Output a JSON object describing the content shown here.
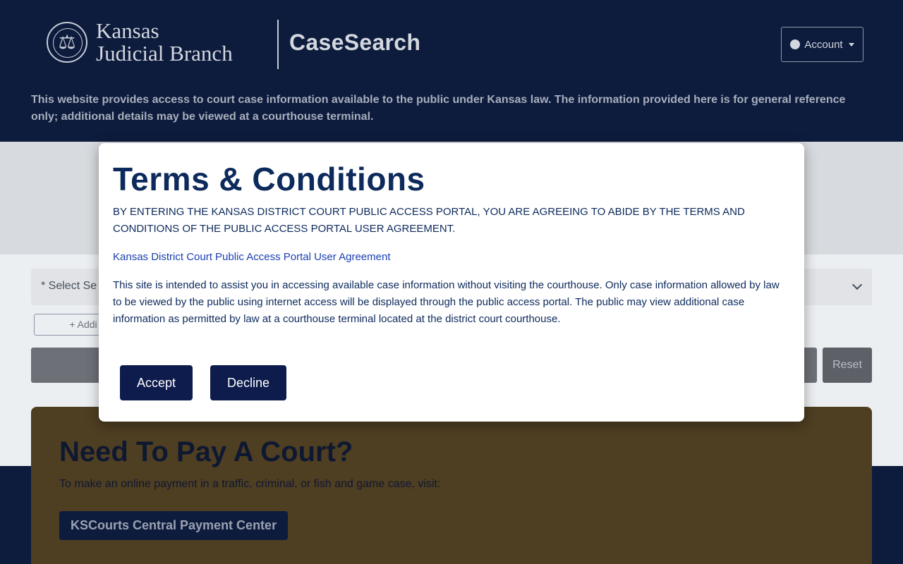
{
  "header": {
    "logo_line1": "Kansas",
    "logo_line2": "Judicial Branch",
    "app_name": "CaseSearch",
    "account_label": "Account",
    "description": "This website provides access to court case information available to the public under Kansas law. The information provided here is for general reference only; additional details may be viewed at a courthouse terminal."
  },
  "search": {
    "select_placeholder": "* Select Se",
    "add_label": "+ Addi",
    "reset_label": "Reset"
  },
  "payment": {
    "title": "Need To Pay A Court?",
    "text": "To make an online payment in a traffic, criminal, or fish and game case, visit:",
    "button_label": "KSCourts Central Payment Center"
  },
  "modal": {
    "title": "Terms & Conditions",
    "upper_text": "BY ENTERING THE KANSAS DISTRICT COURT PUBLIC ACCESS PORTAL, YOU ARE AGREEING TO ABIDE BY THE TERMS AND CONDITIONS OF THE PUBLIC ACCESS PORTAL USER AGREEMENT.",
    "link_text": "Kansas District Court Public Access Portal User Agreement",
    "body_text": "This site is intended to assist you in accessing available case information without visiting the courthouse. Only case information allowed by law to be viewed by the public using internet access will be displayed through the public access portal. The public may view additional case information as permitted by law at a courthouse terminal located at the district court courthouse.",
    "accept_label": "Accept",
    "decline_label": "Decline"
  },
  "colors": {
    "header_bg": "#0d1b3d",
    "modal_title": "#0d2a5c",
    "button_bg": "#0d1b4d",
    "link": "#1a3fb0"
  }
}
